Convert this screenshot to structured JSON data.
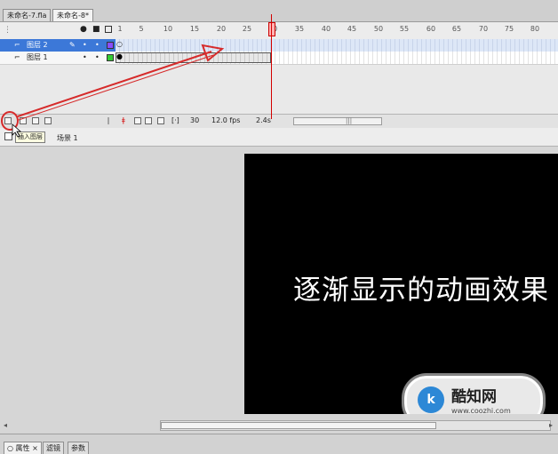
{
  "doc_tabs": [
    {
      "label": "未命名-7.fla"
    },
    {
      "label": "未命名-8*"
    }
  ],
  "timeline": {
    "ruler_ticks": [
      "1",
      "5",
      "10",
      "15",
      "20",
      "25",
      "30",
      "35",
      "40",
      "45",
      "50",
      "55",
      "60",
      "65",
      "70",
      "75",
      "80"
    ],
    "header_icons": [
      "eye-icon",
      "lock-icon",
      "outline-icon"
    ],
    "layers": [
      {
        "name": "图层 2",
        "selected": true,
        "color": "#8a4dff"
      },
      {
        "name": "图层 1",
        "selected": false,
        "color": "#33cc33"
      }
    ],
    "status": {
      "current_frame": "30",
      "fps": "12.0 fps",
      "elapsed": "2.4s"
    }
  },
  "edit_bar": {
    "tooltip": "插入图层",
    "scene": "场景 1"
  },
  "stage": {
    "text": "逐渐显示的动画效果",
    "background": "#000000"
  },
  "watermark": {
    "logo": "k",
    "name": "酷知网",
    "url": "www.coozhi.com"
  },
  "panel_tabs": [
    {
      "label": "○ 属性 ×"
    },
    {
      "label": "滤镜"
    },
    {
      "label": "参数"
    }
  ],
  "colors": {
    "selected_layer": "#3c78d8",
    "playhead": "#d40000",
    "annotation": "#d62b2b"
  }
}
